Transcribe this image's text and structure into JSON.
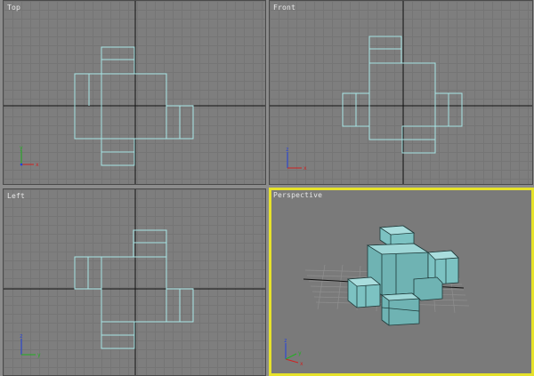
{
  "viewports": {
    "top": {
      "label": "Top"
    },
    "front": {
      "label": "Front"
    },
    "left": {
      "label": "Left"
    },
    "perspective": {
      "label": "Perspective",
      "active": true
    }
  },
  "axis_gizmo": {
    "x": "x",
    "y": "y",
    "z": "z"
  },
  "colors": {
    "wireframe": "#a8e6e6",
    "active_border": "#e6e22a",
    "grid_major": "#000000",
    "axis_x": "#d02020",
    "axis_y": "#20b020",
    "axis_z": "#2040e0",
    "mesh_fill": "#6fb3b3"
  }
}
